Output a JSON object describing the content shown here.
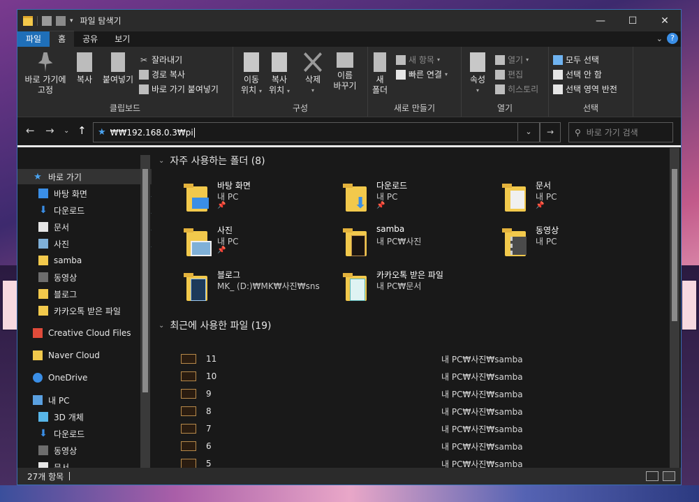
{
  "window": {
    "title": "파일 탐색기",
    "controls": {
      "minimize": "—",
      "maximize": "☐",
      "close": "✕"
    }
  },
  "tabs": {
    "file": "파일",
    "home": "홈",
    "share": "공유",
    "view": "보기",
    "help": "?"
  },
  "ribbon": {
    "clipboard": {
      "label": "클립보드",
      "pin": [
        "바로 가기에",
        "고정"
      ],
      "copy": "복사",
      "paste": "붙여넣기",
      "cut": "잘라내기",
      "copy_path": "경로 복사",
      "paste_shortcut": "바로 가기 붙여넣기"
    },
    "organize": {
      "label": "구성",
      "move": [
        "이동",
        "위치"
      ],
      "copy_to": [
        "복사",
        "위치"
      ],
      "delete": "삭제",
      "rename": [
        "이름",
        "바꾸기"
      ]
    },
    "new": {
      "label": "새로 만들기",
      "new_folder": [
        "새",
        "폴더"
      ],
      "new_item": "새 항목",
      "easy_access": "빠른 연결"
    },
    "open": {
      "label": "열기",
      "properties": "속성",
      "open": "열기",
      "edit": "편집",
      "history": "히스토리"
    },
    "select": {
      "label": "선택",
      "select_all": "모두 선택",
      "select_none": "선택 안 함",
      "invert": "선택 영역 반전"
    }
  },
  "address": {
    "path": "₩₩192.168.0.3₩pi",
    "search_placeholder": "바로 가기 검색"
  },
  "nav": {
    "quick_access": "바로 가기",
    "quick_items": [
      {
        "label": "바탕 화면"
      },
      {
        "label": "다운로드"
      },
      {
        "label": "문서"
      },
      {
        "label": "사진"
      },
      {
        "label": "samba"
      },
      {
        "label": "동영상"
      },
      {
        "label": "블로그"
      },
      {
        "label": "카카오톡 받은 파일"
      }
    ],
    "creative_cloud": "Creative Cloud Files",
    "naver_cloud": "Naver Cloud",
    "onedrive": "OneDrive",
    "this_pc": "내 PC",
    "pc_items": [
      {
        "label": "3D 개체"
      },
      {
        "label": "다운로드"
      },
      {
        "label": "동영상"
      },
      {
        "label": "문서"
      }
    ]
  },
  "frequent": {
    "header": "자주 사용하는 폴더 (8)",
    "items": [
      {
        "name": "바탕 화면",
        "loc": "내 PC",
        "pinned": true
      },
      {
        "name": "다운로드",
        "loc": "내 PC",
        "pinned": true
      },
      {
        "name": "문서",
        "loc": "내 PC",
        "pinned": true
      },
      {
        "name": "사진",
        "loc": "내 PC",
        "pinned": true
      },
      {
        "name": "samba",
        "loc": "내 PC₩사진",
        "pinned": false
      },
      {
        "name": "동영상",
        "loc": "내 PC",
        "pinned": false
      },
      {
        "name": "블로그",
        "loc": "MK_ (D:)₩MK₩사진₩sns",
        "pinned": false
      },
      {
        "name": "카카오톡 받은 파일",
        "loc": "내 PC₩문서",
        "pinned": false
      }
    ]
  },
  "recent": {
    "header": "최근에 사용한 파일 (19)",
    "items": [
      {
        "name": "11",
        "path": "내 PC₩사진₩samba"
      },
      {
        "name": "10",
        "path": "내 PC₩사진₩samba"
      },
      {
        "name": "9",
        "path": "내 PC₩사진₩samba"
      },
      {
        "name": "8",
        "path": "내 PC₩사진₩samba"
      },
      {
        "name": "7",
        "path": "내 PC₩사진₩samba"
      },
      {
        "name": "6",
        "path": "내 PC₩사진₩samba"
      },
      {
        "name": "5",
        "path": "내 PC₩사진₩samba"
      }
    ]
  },
  "status": {
    "count": "27개 항목"
  },
  "colors": {
    "accent": "#1f6fb8",
    "folder": "#f2c94c",
    "background": "#191919",
    "ribbon": "#2b2b2b"
  }
}
